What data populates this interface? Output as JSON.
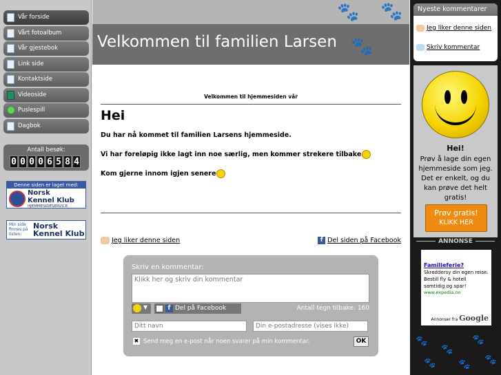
{
  "nav": [
    {
      "label": "Vår forside"
    },
    {
      "label": "Vårt fotoalbum"
    },
    {
      "label": "Vår gjestebok"
    },
    {
      "label": "Link side"
    },
    {
      "label": "Kontaktside"
    },
    {
      "label": "Videoside"
    },
    {
      "label": "Puslespill"
    },
    {
      "label": "Dagbok"
    }
  ],
  "counter": {
    "label": "Antall besøk:",
    "digits": [
      "0",
      "0",
      "0",
      "0",
      "6",
      "5",
      "8",
      "4"
    ]
  },
  "nkk": {
    "badge_top": "Denne siden er laget med:",
    "name_line1": "Norsk",
    "name_line2": "Kennel Klub",
    "service": "HJEMMESIDESERVICE",
    "badge2_small": "Min side finnes på listen:",
    "badge2_name": "Norsk Kennel Klub"
  },
  "header": {
    "title": "Velkommen til familien Larsen"
  },
  "main": {
    "welcome_small": "Velkommen til hjemmesiden vår",
    "heading": "Hei",
    "p1": "Du har nå kommet til familien Larsens hjemmeside.",
    "p2": "Vi har foreløpig ikke lagt inn noe særlig, men kommer strekere tilbake",
    "p3": "Kom gjerne innom igjen senere",
    "like_link": "Jeg liker denne siden",
    "fb_share": "Del siden på Facebook"
  },
  "comment": {
    "title": "Skriv en kommentar:",
    "textarea_placeholder": "Klikk her og skriv din kommentar",
    "fb_button": "Del på Facebook",
    "chars_left": "Antall tegn tilbake: 160",
    "name_placeholder": "Ditt navn",
    "email_placeholder": "Din e-postadresse (vises ikke)",
    "notify_label": "Send meg en e-post når noen svarer på min kommentar.",
    "ok_label": "OK"
  },
  "right": {
    "recent_title": "Nyeste kommentarer",
    "recent_link1": "Jeg liker denne siden",
    "recent_link2": "Skriv kommentar",
    "ad_hei": "Hei!",
    "ad_text": "Prøv å lage din egen hjemmeside som jeg. Det er enkelt, og du kan prøve det helt gratis!",
    "ad_btn_line1": "Prøv gratis!",
    "ad_btn_line2": "KLIKK HER",
    "annonse": "ANNONSE",
    "gad_title": "Familieferie?",
    "gad_body": "Skreddersy din egen reise. Bestill fly & hotell samtidig og spar!",
    "gad_url": "www.expedia.no",
    "gad_foot_text": "Annonser fra",
    "gad_foot_brand": "Google"
  }
}
